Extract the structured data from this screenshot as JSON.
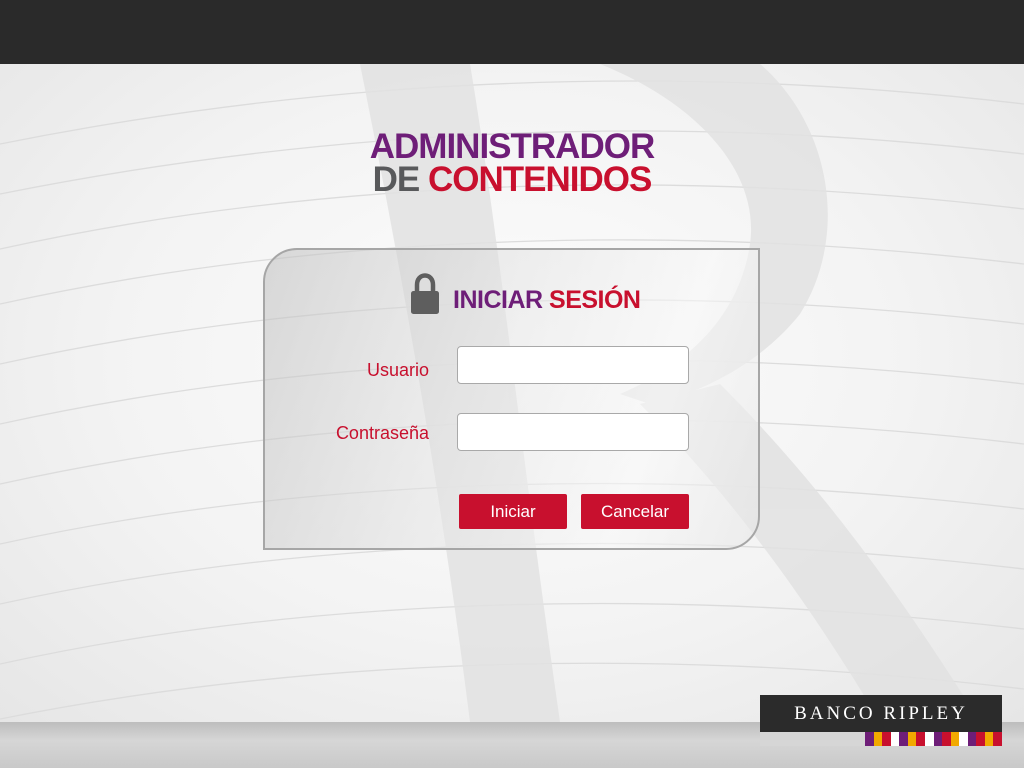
{
  "title": {
    "line1": "ADMINISTRADOR",
    "line2_part1": "DE",
    "line2_part2": "CONTENIDOS"
  },
  "login": {
    "title_part1": "INICIAR",
    "title_part2": "SESIÓN",
    "username_label": "Usuario",
    "username_value": "",
    "password_label": "Contraseña",
    "password_value": "",
    "submit_label": "Iniciar",
    "cancel_label": "Cancelar"
  },
  "brand": {
    "name": "BANCO RIPLEY",
    "stripe_colors": [
      "#6e1e78",
      "#f2a900",
      "#c8102e",
      "#ffffff",
      "#6e1e78",
      "#f2a900",
      "#c8102e",
      "#ffffff",
      "#6e1e78",
      "#c8102e",
      "#f2a900",
      "#ffffff",
      "#6e1e78",
      "#c8102e",
      "#f2a900",
      "#c8102e"
    ]
  },
  "colors": {
    "purple": "#6e1e78",
    "red": "#c8102e",
    "gray": "#58595b"
  },
  "icons": [
    "lock-icon"
  ]
}
